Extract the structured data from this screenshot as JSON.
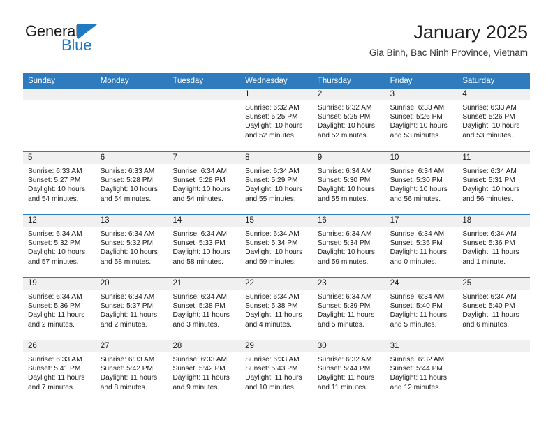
{
  "brand": {
    "name_part1": "General",
    "name_part2": "Blue",
    "accent_color": "#1f7ac1"
  },
  "header": {
    "title": "January 2025",
    "subtitle": "Gia Binh, Bac Ninh Province, Vietnam"
  },
  "theme": {
    "header_row_bg": "#2e7cbe",
    "day_band_bg": "#f0f0f0",
    "grid_line": "#2e7cbe"
  },
  "weekdays": [
    "Sunday",
    "Monday",
    "Tuesday",
    "Wednesday",
    "Thursday",
    "Friday",
    "Saturday"
  ],
  "labels": {
    "sunrise": "Sunrise:",
    "sunset": "Sunset:",
    "daylight": "Daylight:"
  },
  "weeks": [
    [
      {
        "day": "",
        "empty": true
      },
      {
        "day": "",
        "empty": true
      },
      {
        "day": "",
        "empty": true
      },
      {
        "day": "1",
        "sunrise": "Sunrise: 6:32 AM",
        "sunset": "Sunset: 5:25 PM",
        "daylight1": "Daylight: 10 hours",
        "daylight2": "and 52 minutes."
      },
      {
        "day": "2",
        "sunrise": "Sunrise: 6:32 AM",
        "sunset": "Sunset: 5:25 PM",
        "daylight1": "Daylight: 10 hours",
        "daylight2": "and 52 minutes."
      },
      {
        "day": "3",
        "sunrise": "Sunrise: 6:33 AM",
        "sunset": "Sunset: 5:26 PM",
        "daylight1": "Daylight: 10 hours",
        "daylight2": "and 53 minutes."
      },
      {
        "day": "4",
        "sunrise": "Sunrise: 6:33 AM",
        "sunset": "Sunset: 5:26 PM",
        "daylight1": "Daylight: 10 hours",
        "daylight2": "and 53 minutes."
      }
    ],
    [
      {
        "day": "5",
        "sunrise": "Sunrise: 6:33 AM",
        "sunset": "Sunset: 5:27 PM",
        "daylight1": "Daylight: 10 hours",
        "daylight2": "and 54 minutes."
      },
      {
        "day": "6",
        "sunrise": "Sunrise: 6:33 AM",
        "sunset": "Sunset: 5:28 PM",
        "daylight1": "Daylight: 10 hours",
        "daylight2": "and 54 minutes."
      },
      {
        "day": "7",
        "sunrise": "Sunrise: 6:34 AM",
        "sunset": "Sunset: 5:28 PM",
        "daylight1": "Daylight: 10 hours",
        "daylight2": "and 54 minutes."
      },
      {
        "day": "8",
        "sunrise": "Sunrise: 6:34 AM",
        "sunset": "Sunset: 5:29 PM",
        "daylight1": "Daylight: 10 hours",
        "daylight2": "and 55 minutes."
      },
      {
        "day": "9",
        "sunrise": "Sunrise: 6:34 AM",
        "sunset": "Sunset: 5:30 PM",
        "daylight1": "Daylight: 10 hours",
        "daylight2": "and 55 minutes."
      },
      {
        "day": "10",
        "sunrise": "Sunrise: 6:34 AM",
        "sunset": "Sunset: 5:30 PM",
        "daylight1": "Daylight: 10 hours",
        "daylight2": "and 56 minutes."
      },
      {
        "day": "11",
        "sunrise": "Sunrise: 6:34 AM",
        "sunset": "Sunset: 5:31 PM",
        "daylight1": "Daylight: 10 hours",
        "daylight2": "and 56 minutes."
      }
    ],
    [
      {
        "day": "12",
        "sunrise": "Sunrise: 6:34 AM",
        "sunset": "Sunset: 5:32 PM",
        "daylight1": "Daylight: 10 hours",
        "daylight2": "and 57 minutes."
      },
      {
        "day": "13",
        "sunrise": "Sunrise: 6:34 AM",
        "sunset": "Sunset: 5:32 PM",
        "daylight1": "Daylight: 10 hours",
        "daylight2": "and 58 minutes."
      },
      {
        "day": "14",
        "sunrise": "Sunrise: 6:34 AM",
        "sunset": "Sunset: 5:33 PM",
        "daylight1": "Daylight: 10 hours",
        "daylight2": "and 58 minutes."
      },
      {
        "day": "15",
        "sunrise": "Sunrise: 6:34 AM",
        "sunset": "Sunset: 5:34 PM",
        "daylight1": "Daylight: 10 hours",
        "daylight2": "and 59 minutes."
      },
      {
        "day": "16",
        "sunrise": "Sunrise: 6:34 AM",
        "sunset": "Sunset: 5:34 PM",
        "daylight1": "Daylight: 10 hours",
        "daylight2": "and 59 minutes."
      },
      {
        "day": "17",
        "sunrise": "Sunrise: 6:34 AM",
        "sunset": "Sunset: 5:35 PM",
        "daylight1": "Daylight: 11 hours",
        "daylight2": "and 0 minutes."
      },
      {
        "day": "18",
        "sunrise": "Sunrise: 6:34 AM",
        "sunset": "Sunset: 5:36 PM",
        "daylight1": "Daylight: 11 hours",
        "daylight2": "and 1 minute."
      }
    ],
    [
      {
        "day": "19",
        "sunrise": "Sunrise: 6:34 AM",
        "sunset": "Sunset: 5:36 PM",
        "daylight1": "Daylight: 11 hours",
        "daylight2": "and 2 minutes."
      },
      {
        "day": "20",
        "sunrise": "Sunrise: 6:34 AM",
        "sunset": "Sunset: 5:37 PM",
        "daylight1": "Daylight: 11 hours",
        "daylight2": "and 2 minutes."
      },
      {
        "day": "21",
        "sunrise": "Sunrise: 6:34 AM",
        "sunset": "Sunset: 5:38 PM",
        "daylight1": "Daylight: 11 hours",
        "daylight2": "and 3 minutes."
      },
      {
        "day": "22",
        "sunrise": "Sunrise: 6:34 AM",
        "sunset": "Sunset: 5:38 PM",
        "daylight1": "Daylight: 11 hours",
        "daylight2": "and 4 minutes."
      },
      {
        "day": "23",
        "sunrise": "Sunrise: 6:34 AM",
        "sunset": "Sunset: 5:39 PM",
        "daylight1": "Daylight: 11 hours",
        "daylight2": "and 5 minutes."
      },
      {
        "day": "24",
        "sunrise": "Sunrise: 6:34 AM",
        "sunset": "Sunset: 5:40 PM",
        "daylight1": "Daylight: 11 hours",
        "daylight2": "and 5 minutes."
      },
      {
        "day": "25",
        "sunrise": "Sunrise: 6:34 AM",
        "sunset": "Sunset: 5:40 PM",
        "daylight1": "Daylight: 11 hours",
        "daylight2": "and 6 minutes."
      }
    ],
    [
      {
        "day": "26",
        "sunrise": "Sunrise: 6:33 AM",
        "sunset": "Sunset: 5:41 PM",
        "daylight1": "Daylight: 11 hours",
        "daylight2": "and 7 minutes."
      },
      {
        "day": "27",
        "sunrise": "Sunrise: 6:33 AM",
        "sunset": "Sunset: 5:42 PM",
        "daylight1": "Daylight: 11 hours",
        "daylight2": "and 8 minutes."
      },
      {
        "day": "28",
        "sunrise": "Sunrise: 6:33 AM",
        "sunset": "Sunset: 5:42 PM",
        "daylight1": "Daylight: 11 hours",
        "daylight2": "and 9 minutes."
      },
      {
        "day": "29",
        "sunrise": "Sunrise: 6:33 AM",
        "sunset": "Sunset: 5:43 PM",
        "daylight1": "Daylight: 11 hours",
        "daylight2": "and 10 minutes."
      },
      {
        "day": "30",
        "sunrise": "Sunrise: 6:32 AM",
        "sunset": "Sunset: 5:44 PM",
        "daylight1": "Daylight: 11 hours",
        "daylight2": "and 11 minutes."
      },
      {
        "day": "31",
        "sunrise": "Sunrise: 6:32 AM",
        "sunset": "Sunset: 5:44 PM",
        "daylight1": "Daylight: 11 hours",
        "daylight2": "and 12 minutes."
      },
      {
        "day": "",
        "empty": true
      }
    ]
  ]
}
